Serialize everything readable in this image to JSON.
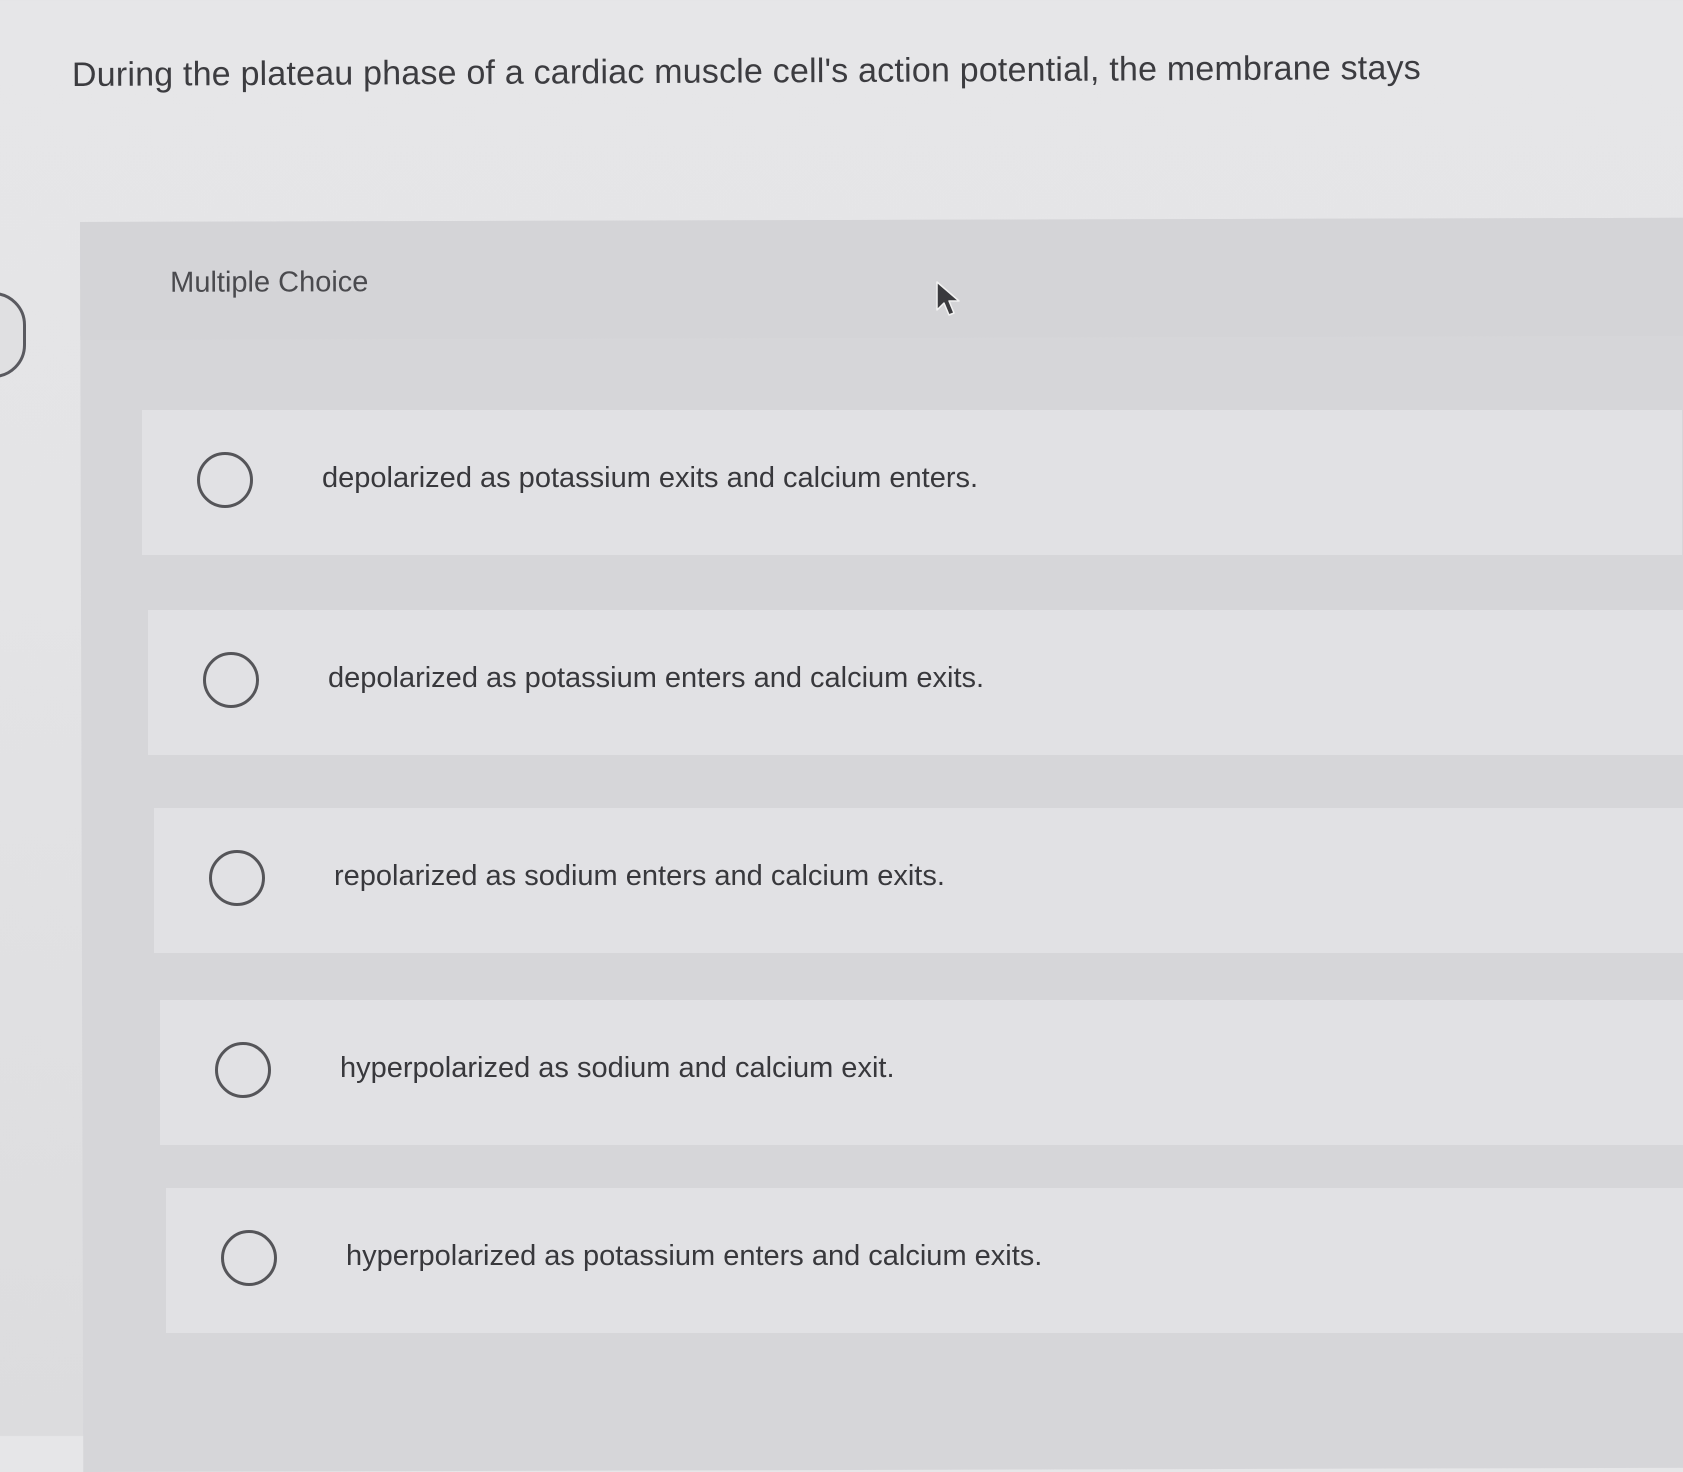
{
  "question": {
    "text": "During the plateau phase of a cardiac muscle cell's action potential, the membrane stays"
  },
  "section": {
    "label": "Multiple Choice"
  },
  "choices": [
    {
      "text": "depolarized as potassium exits and calcium enters."
    },
    {
      "text": "depolarized as potassium enters and calcium exits."
    },
    {
      "text": "repolarized as sodium enters and calcium exits."
    },
    {
      "text": "hyperpolarized as sodium and calcium exit."
    },
    {
      "text": "hyperpolarized as potassium enters and calcium exits."
    }
  ],
  "icons": {
    "cursor": "mouse-pointer-icon",
    "radio": "radio-button-icon"
  },
  "colors": {
    "background": "#e4e4e6",
    "panel": "#d6d6d9",
    "text": "#3c3c40",
    "radio_border": "#555559"
  }
}
